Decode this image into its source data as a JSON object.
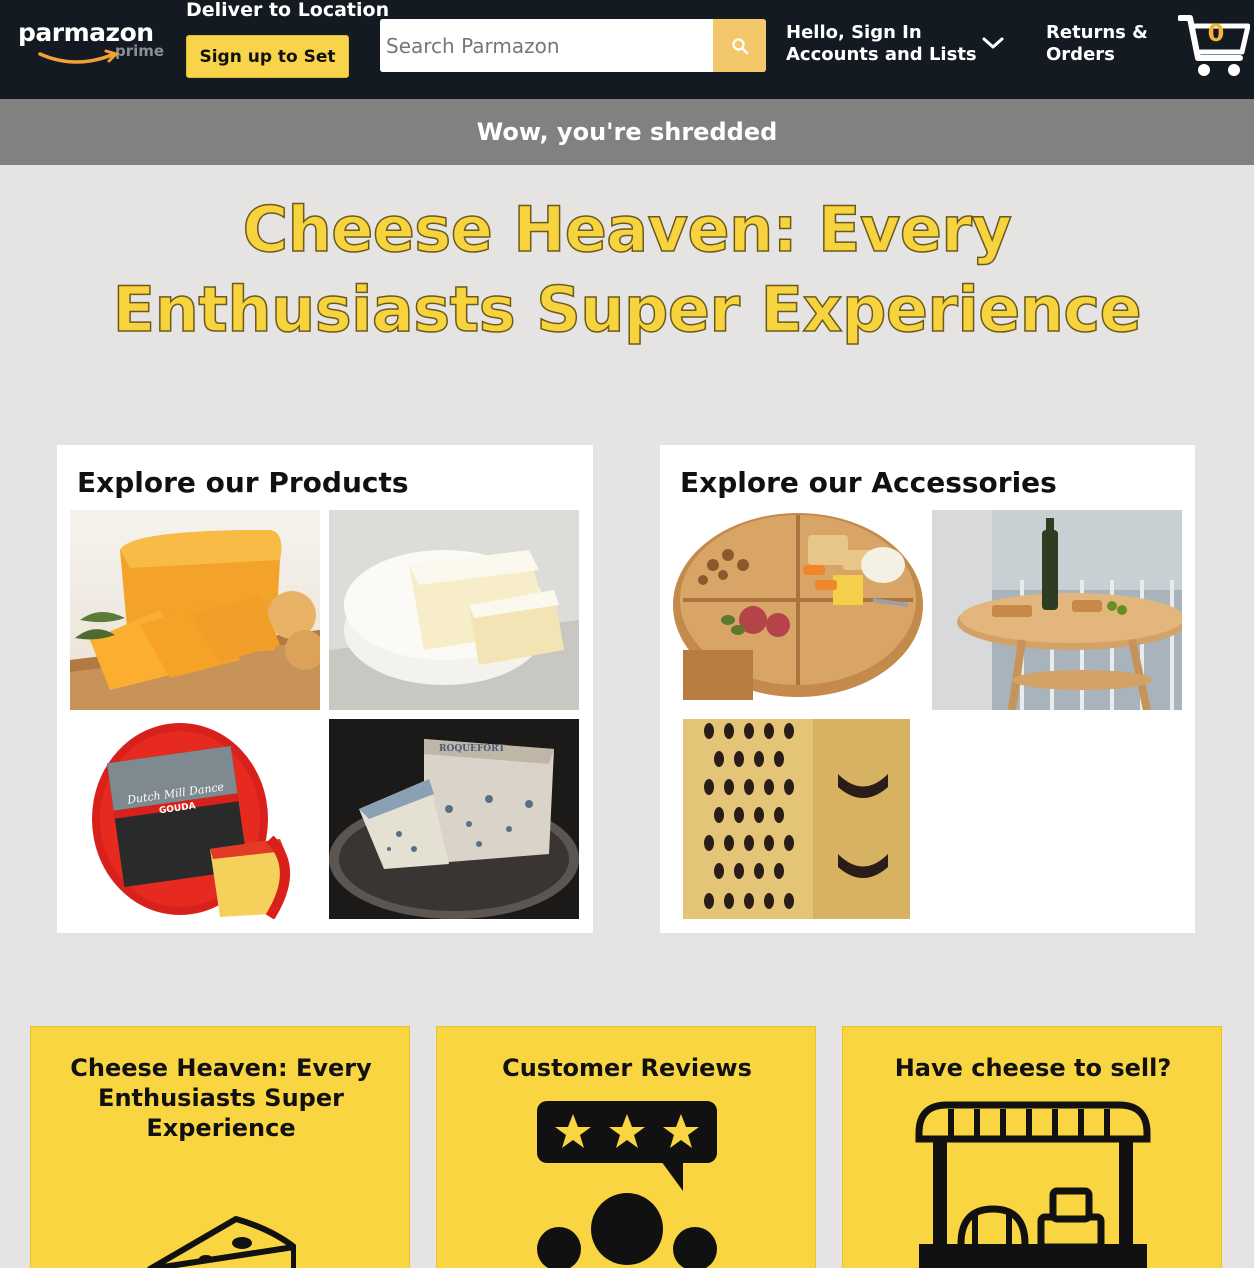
{
  "header": {
    "logo": {
      "word": "parmazon",
      "sub": "prime"
    },
    "deliver_label": "Deliver to Location",
    "signup_label": "Sign up to Set",
    "search": {
      "placeholder": "Search Parmazon",
      "value": ""
    },
    "account": {
      "line1": "Hello, Sign In",
      "line2": "Accounts and Lists"
    },
    "returns": {
      "line1": "Returns &",
      "line2": "Orders"
    },
    "cart": {
      "count": "0"
    }
  },
  "banner": {
    "text": "Wow, you're shredded"
  },
  "hero": {
    "title": "Cheese Heaven: Every Enthusiasts Super Experience"
  },
  "products": {
    "title": "Explore our Products",
    "items": [
      "cheddar cheese",
      "brie cheese",
      "gouda cheese",
      "roquefort cheese"
    ],
    "gouda_label": {
      "brand": "Dutch Mill Dance",
      "name": "GOUDA"
    },
    "roquefort_label": "ROQUEFORT"
  },
  "accessories": {
    "title": "Explore our Accessories",
    "items": [
      "charcuterie board",
      "wine table",
      "cheese grater"
    ]
  },
  "bottom_cards": [
    {
      "title": "Cheese Heaven: Every Enthusiasts Super Experience",
      "icon": "cheese-icon"
    },
    {
      "title": "Customer Reviews",
      "icon": "reviews-icon"
    },
    {
      "title": "Have cheese to sell?",
      "icon": "market-stall-icon"
    }
  ],
  "colors": {
    "header_bg": "#131a22",
    "accent_yellow": "#f8d44a",
    "banner_gray": "#818181",
    "page_bg": "#e6e4e3",
    "hero_text": "#f7d33d"
  }
}
